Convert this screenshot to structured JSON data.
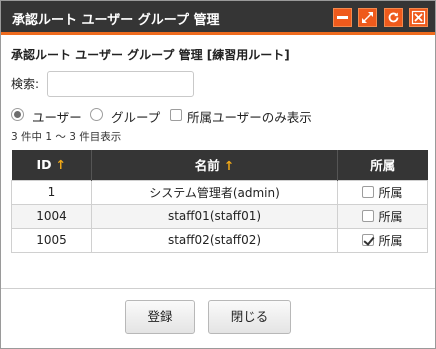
{
  "window": {
    "title": "承認ルート ユーザー グループ 管理"
  },
  "heading": "承認ルート ユーザー グループ 管理 [練習用ルート]",
  "search": {
    "label": "検索:",
    "value": "",
    "placeholder": ""
  },
  "filter": {
    "user_label": "ユーザー",
    "group_label": "グループ",
    "members_only_label": "所属ユーザーのみ表示",
    "selected": "user",
    "members_only_checked": false
  },
  "count_text": "3 件中 1 ～ 3 件目表示",
  "table": {
    "columns": [
      "ID",
      "名前",
      "所属"
    ],
    "sort_arrow": "↑",
    "rows": [
      {
        "id": "1",
        "name": "システム管理者(admin)",
        "member_label": "所属",
        "checked": false
      },
      {
        "id": "1004",
        "name": "staff01(staff01)",
        "member_label": "所属",
        "checked": false
      },
      {
        "id": "1005",
        "name": "staff02(staff02)",
        "member_label": "所属",
        "checked": true
      }
    ]
  },
  "buttons": {
    "register": "登録",
    "close": "閉じる"
  },
  "colors": {
    "titlebar": "#353535",
    "accent": "#ef5a1c",
    "header": "#353535",
    "sort_arrow": "#f0a818"
  }
}
